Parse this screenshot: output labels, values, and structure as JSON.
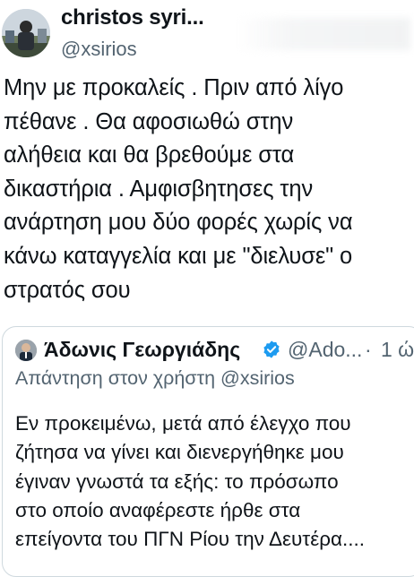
{
  "author": {
    "name": "christos syri...",
    "handle": "@xsirios"
  },
  "tweet": {
    "lines": [
      "Μην με προκαλείς . Πριν από λίγο",
      "πέθανε . Θα αφοσιωθώ στην",
      "αλήθεια και θα βρεθούμε στα",
      "δικαστήρια . Αμφισβητησες την",
      "ανάρτηση μου δύο φορές χωρίς να",
      "κάνω καταγγελία και με \"διελυσε\" ο",
      "στρατός σου"
    ]
  },
  "quoted": {
    "name": "Άδωνις Γεωργιάδης",
    "handle": "@Ado...",
    "separator": "·",
    "time": "1 ώ",
    "reply_to": "Απάντηση στον χρήστη @xsirios",
    "lines": [
      "Εν προκειμένω, μετά από έλεγχο που",
      "ζήτησα να γίνει και διενεργήθηκε μου",
      "έγιναν γνωστά τα εξής: το πρόσωπο",
      "στο οποίο αναφέρεστε ήρθε στα",
      "επείγοντα του ΠΓΝ Ρίου την Δευτέρα...."
    ]
  },
  "colors": {
    "text": "#0f1419",
    "secondary": "#536471",
    "verified": "#1d9bf0",
    "border": "#cfd9de"
  },
  "icons": {
    "verified": "verified-badge-icon"
  }
}
